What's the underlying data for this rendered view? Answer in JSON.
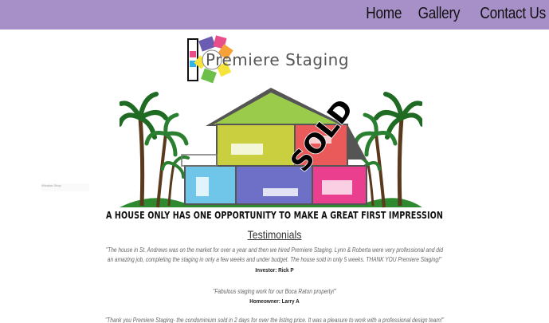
{
  "nav": {
    "items": [
      {
        "label": "Home"
      },
      {
        "label": "Gallery"
      },
      {
        "label": "Contact Us"
      }
    ]
  },
  "logo": {
    "word1": "Premiere",
    "word2": "Staging",
    "brand_colors": [
      "#e94d8a",
      "#f7a238",
      "#f6e43c",
      "#6cc04a",
      "#35b3e6",
      "#6b5bb1"
    ]
  },
  "hero": {
    "badge_text": "SOLD",
    "room_colors": [
      "#c9cf3f",
      "#9acb4a",
      "#ea5a5a",
      "#6fc6e8",
      "#6e6fc6",
      "#ea3f8f"
    ]
  },
  "widget": {
    "label": "Window Shop"
  },
  "tagline": "A HOUSE ONLY HAS ONE OPPORTUNITY TO MAKE A GREAT FIRST IMPRESSION",
  "testimonials": {
    "heading": "Testimonials",
    "items": [
      {
        "quote_line1": "\"The house in St. Andrews was on the market for over a year and then we hired Premiere Staging. Lynn & Roberta were very professional and did",
        "quote_line2": "an amazing job, completing the staging in only a few weeks and under budget. The house sold in only 5 weeks. THANK YOU Premiere Staging!\"",
        "author": "Investor: Rick P"
      },
      {
        "quote_line1": "\"Fabulous staging work for our Boca Raton property!\"",
        "quote_line2": "",
        "author": "Homeowner: Larry A"
      },
      {
        "quote_line1": "\"Thank you Premiere Staging- the condominium sold in 2 days for over the listing price. It was a pleasure to work with a professional design team!\"",
        "quote_line2": "",
        "author": ""
      }
    ]
  }
}
